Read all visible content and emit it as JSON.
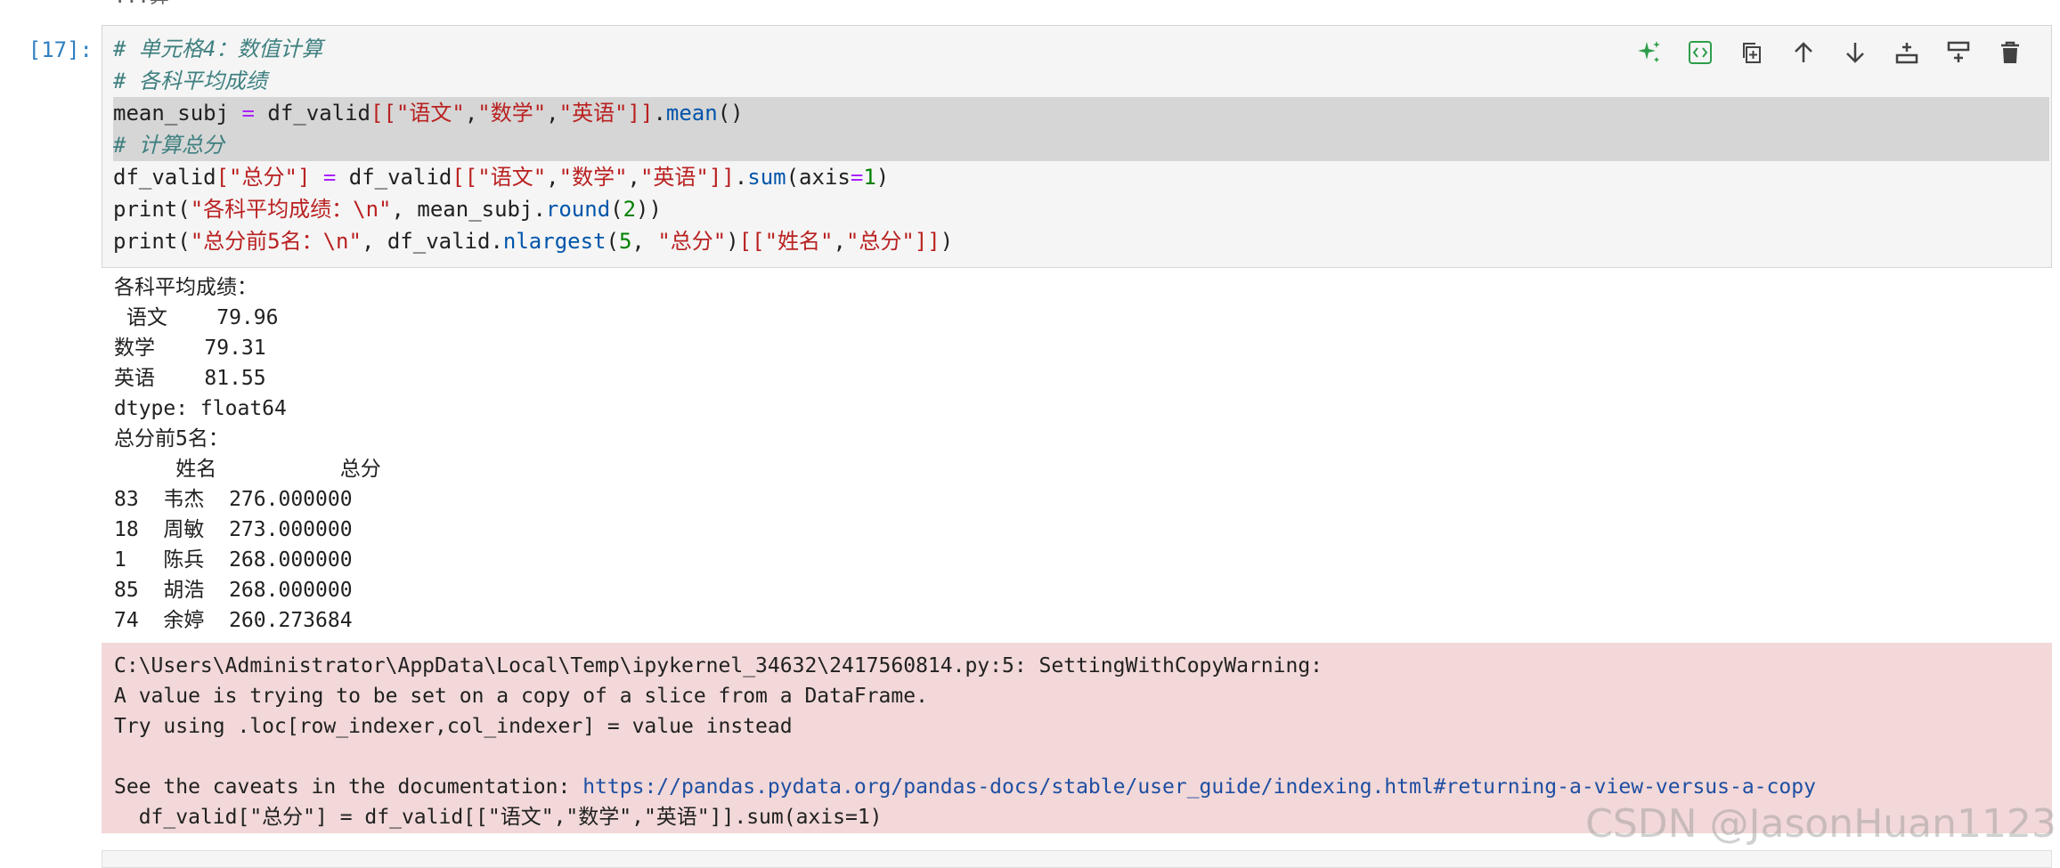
{
  "top_fragment": "...算",
  "cell": {
    "prompt": "[17]:",
    "code_lines": [
      {
        "parts": [
          {
            "t": "# 单元格4：数值计算",
            "c": "com"
          }
        ]
      },
      {
        "parts": [
          {
            "t": "# 各科平均成绩",
            "c": "com"
          }
        ]
      },
      {
        "highlight": true,
        "parts": [
          {
            "t": "mean_subj ",
            "c": ""
          },
          {
            "t": "=",
            "c": "op"
          },
          {
            "t": " df_valid",
            "c": ""
          },
          {
            "t": "[[",
            "c": "str"
          },
          {
            "t": "\"语文\"",
            "c": "str"
          },
          {
            "t": ",",
            "c": ""
          },
          {
            "t": "\"数学\"",
            "c": "str"
          },
          {
            "t": ",",
            "c": ""
          },
          {
            "t": "\"英语\"",
            "c": "str"
          },
          {
            "t": "]]",
            "c": "str"
          },
          {
            "t": ".",
            "c": ""
          },
          {
            "t": "mean",
            "c": "attr"
          },
          {
            "t": "()",
            "c": ""
          }
        ]
      },
      {
        "highlight": true,
        "parts": [
          {
            "t": "# 计算总分",
            "c": "com"
          }
        ]
      },
      {
        "parts": [
          {
            "t": "df_valid",
            "c": ""
          },
          {
            "t": "[",
            "c": "str"
          },
          {
            "t": "\"总分\"",
            "c": "str"
          },
          {
            "t": "]",
            "c": "str"
          },
          {
            "t": " ",
            "c": ""
          },
          {
            "t": "=",
            "c": "op"
          },
          {
            "t": " df_valid",
            "c": ""
          },
          {
            "t": "[[",
            "c": "str"
          },
          {
            "t": "\"语文\"",
            "c": "str"
          },
          {
            "t": ",",
            "c": ""
          },
          {
            "t": "\"数学\"",
            "c": "str"
          },
          {
            "t": ",",
            "c": ""
          },
          {
            "t": "\"英语\"",
            "c": "str"
          },
          {
            "t": "]]",
            "c": "str"
          },
          {
            "t": ".",
            "c": ""
          },
          {
            "t": "sum",
            "c": "attr"
          },
          {
            "t": "(axis",
            "c": ""
          },
          {
            "t": "=",
            "c": "op"
          },
          {
            "t": "1",
            "c": "num"
          },
          {
            "t": ")",
            "c": ""
          }
        ]
      },
      {
        "parts": [
          {
            "t": "print",
            "c": ""
          },
          {
            "t": "(",
            "c": ""
          },
          {
            "t": "\"各科平均成绩：\\n\"",
            "c": "str"
          },
          {
            "t": ", mean_subj.",
            "c": ""
          },
          {
            "t": "round",
            "c": "attr"
          },
          {
            "t": "(",
            "c": ""
          },
          {
            "t": "2",
            "c": "num"
          },
          {
            "t": "))",
            "c": ""
          }
        ]
      },
      {
        "parts": [
          {
            "t": "print",
            "c": ""
          },
          {
            "t": "(",
            "c": ""
          },
          {
            "t": "\"总分前5名：\\n\"",
            "c": "str"
          },
          {
            "t": ", df_valid.",
            "c": ""
          },
          {
            "t": "nlargest",
            "c": "attr"
          },
          {
            "t": "(",
            "c": ""
          },
          {
            "t": "5",
            "c": "num"
          },
          {
            "t": ", ",
            "c": ""
          },
          {
            "t": "\"总分\"",
            "c": "str"
          },
          {
            "t": ")",
            "c": ""
          },
          {
            "t": "[[",
            "c": "str"
          },
          {
            "t": "\"姓名\"",
            "c": "str"
          },
          {
            "t": ",",
            "c": ""
          },
          {
            "t": "\"总分\"",
            "c": "str"
          },
          {
            "t": "]]",
            "c": "str"
          },
          {
            "t": ")",
            "c": ""
          }
        ]
      }
    ]
  },
  "toolbar": [
    {
      "name": "sparkle-ai-icon",
      "color": "#2e9e4a"
    },
    {
      "name": "code-snippet-icon",
      "color": "#2e9e4a"
    },
    {
      "name": "duplicate-icon",
      "color": "#424242"
    },
    {
      "name": "arrow-up-icon",
      "color": "#424242"
    },
    {
      "name": "arrow-down-icon",
      "color": "#424242"
    },
    {
      "name": "insert-above-icon",
      "color": "#424242"
    },
    {
      "name": "insert-below-icon",
      "color": "#424242"
    },
    {
      "name": "trash-icon",
      "color": "#424242"
    }
  ],
  "output_lines": [
    "各科平均成绩：",
    " 语文    79.96",
    "数学    79.31",
    "英语    81.55",
    "dtype: float64",
    "总分前5名：",
    "     姓名          总分",
    "83  韦杰  276.000000",
    "18  周敏  273.000000",
    "1   陈兵  268.000000",
    "85  胡浩  268.000000",
    "74  余婷  260.273684"
  ],
  "stderr": {
    "lines": [
      "C:\\Users\\Administrator\\AppData\\Local\\Temp\\ipykernel_34632\\2417560814.py:5: SettingWithCopyWarning:",
      "A value is trying to be set on a copy of a slice from a DataFrame.",
      "Try using .loc[row_indexer,col_indexer] = value instead",
      ""
    ],
    "caveats_prefix": "See the caveats in the documentation: ",
    "caveats_link": "https://pandas.pydata.org/pandas-docs/stable/user_guide/indexing.html#returning-a-view-versus-a-copy",
    "source_line": "  df_valid[\"总分\"] = df_valid[[\"语文\",\"数学\",\"英语\"]].sum(axis=1)"
  },
  "watermark": "CSDN @JasonHuan1123"
}
